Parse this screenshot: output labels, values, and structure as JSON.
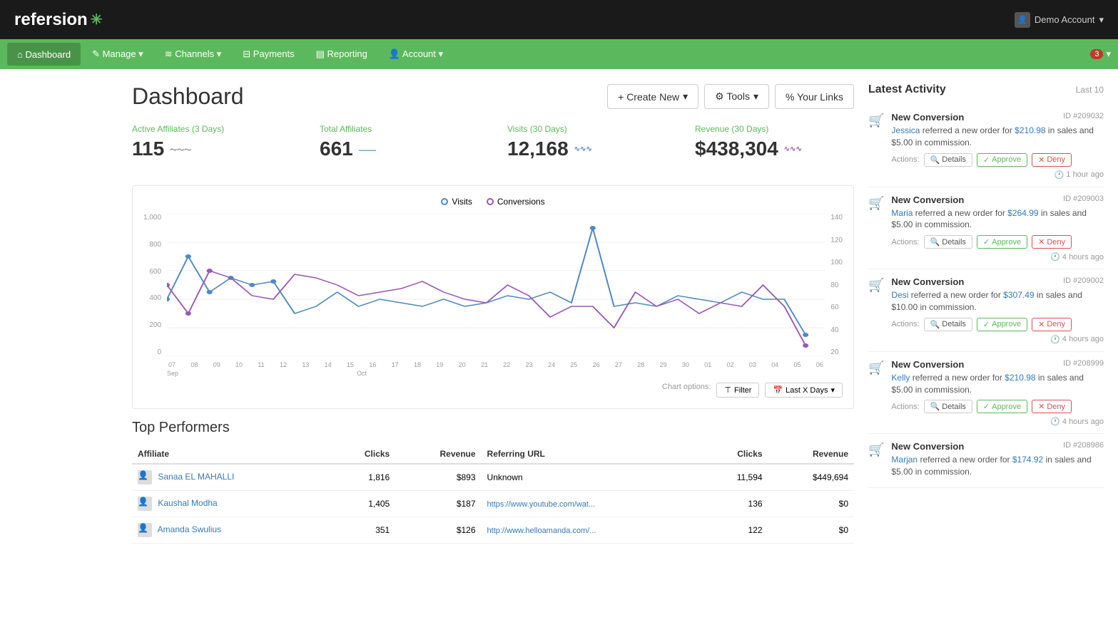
{
  "app": {
    "name": "refersion",
    "star": "✳"
  },
  "header": {
    "account": "Demo Account",
    "dropdown": "▾"
  },
  "nav": {
    "items": [
      {
        "label": "Dashboard",
        "icon": "⌂",
        "active": true
      },
      {
        "label": "Manage",
        "icon": "✎",
        "dropdown": true
      },
      {
        "label": "Channels",
        "icon": "≋",
        "dropdown": true
      },
      {
        "label": "Payments",
        "icon": "⊟",
        "dropdown": false
      },
      {
        "label": "Reporting",
        "icon": "▤",
        "dropdown": false
      },
      {
        "label": "Account",
        "icon": "👤",
        "dropdown": true
      }
    ],
    "badge": "3"
  },
  "page": {
    "title": "Dashboard",
    "actions": {
      "create": "+ Create New",
      "tools": "⚙ Tools",
      "links": "% Your Links"
    }
  },
  "stats": [
    {
      "label": "Active Affiliates (3 Days)",
      "value": "115",
      "sparkline": "〜"
    },
    {
      "label": "Total Affiliates",
      "value": "661",
      "sparkline": "⁻"
    },
    {
      "label": "Visits (30 Days)",
      "value": "12,168",
      "sparkline": "∿"
    },
    {
      "label": "Revenue (30 Days)",
      "value": "$438,304",
      "sparkline": "∿"
    }
  ],
  "chart": {
    "legend": [
      {
        "label": "Visits",
        "color": "#4e89c5"
      },
      {
        "label": "Conversions",
        "color": "#9b59b6"
      }
    ],
    "yLeft": [
      "1,000",
      "800",
      "600",
      "400",
      "200",
      "0"
    ],
    "yRight": [
      "140",
      "120",
      "100",
      "80",
      "60",
      "40",
      "20"
    ],
    "xLabels": [
      "07",
      "08",
      "09",
      "10",
      "11",
      "12",
      "13",
      "14",
      "15",
      "16",
      "17",
      "18",
      "19",
      "20",
      "21",
      "22",
      "23",
      "24",
      "25",
      "26",
      "27",
      "28",
      "29",
      "30",
      "01",
      "02",
      "03",
      "04",
      "05",
      "06"
    ],
    "monthLabels": [
      "Sep",
      "Oct"
    ],
    "options": {
      "filter": "Filter",
      "range": "Last X Days"
    }
  },
  "topPerformers": {
    "title": "Top Performers",
    "columns": {
      "affiliate": "Affiliate",
      "clicks": "Clicks",
      "revenue": "Revenue",
      "referringUrl": "Referring URL",
      "urlClicks": "Clicks",
      "urlRevenue": "Revenue"
    },
    "rows": [
      {
        "name": "Sanaa EL MAHALLI",
        "clicks": "1,816",
        "revenue": "$893",
        "url": "Unknown",
        "urlClicks": "11,594",
        "urlRevenue": "$449,694"
      },
      {
        "name": "Kaushal Modha",
        "clicks": "1,405",
        "revenue": "$187",
        "url": "https://www.youtube.com/wat...",
        "urlClicks": "136",
        "urlRevenue": "$0"
      },
      {
        "name": "Amanda Swulius",
        "clicks": "351",
        "revenue": "$126",
        "url": "http://www.helloamanda.com/...",
        "urlClicks": "122",
        "urlRevenue": "$0"
      }
    ]
  },
  "latestActivity": {
    "title": "Latest Activity",
    "subtitle": "Last 10",
    "items": [
      {
        "type": "New Conversion",
        "id": "ID #209032",
        "affiliate": "Jessica",
        "amount": "$210.98",
        "commission": "$5.00",
        "time": "1 hour ago"
      },
      {
        "type": "New Conversion",
        "id": "ID #209003",
        "affiliate": "Maria",
        "amount": "$264.99",
        "commission": "$5.00",
        "time": "4 hours ago"
      },
      {
        "type": "New Conversion",
        "id": "ID #209002",
        "affiliate": "Desi",
        "amount": "$307.49",
        "commission": "$10.00",
        "time": "4 hours ago"
      },
      {
        "type": "New Conversion",
        "id": "ID #208999",
        "affiliate": "Kelly",
        "amount": "$210.98",
        "commission": "$5.00",
        "time": "4 hours ago"
      },
      {
        "type": "New Conversion",
        "id": "ID #208986",
        "affiliate": "Marjan",
        "amount": "$174.92",
        "commission": "$5.00",
        "time": ""
      }
    ],
    "actions": {
      "details": "Details",
      "approve": "Approve",
      "deny": "Deny",
      "actionsLabel": "Actions:"
    }
  }
}
